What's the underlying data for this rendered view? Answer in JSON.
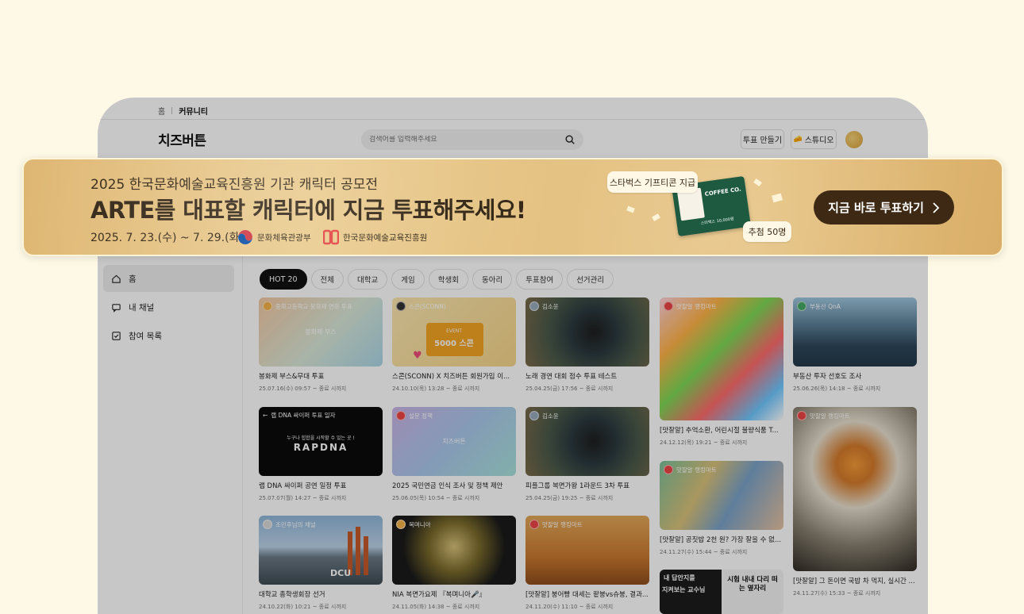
{
  "breadcrumb": {
    "home": "홈",
    "current": "커뮤니티"
  },
  "header": {
    "logo": "치즈버튼",
    "search_placeholder": "검색어를 입력해주세요",
    "make_vote": "투표 만들기",
    "studio": "스튜디오"
  },
  "banner": {
    "subtitle": "2025 한국문화예술교육진흥원 기관 캐릭터 공모전",
    "title": "ARTE를 대표할 캐릭터에 지금 투표해주세요!",
    "date": "2025. 7. 23.(수) ~ 7. 29.(화)",
    "org1": "문화체육관광부",
    "org2": "한국문화예술교육진흥원",
    "prize_label": "스타벅스 기프티콘 지급",
    "winners": "추첨 50명",
    "gift_brand": "COFFEE CO.",
    "gift_amount": "스타벅스 10,000원",
    "cta": "지금 바로 투표하기"
  },
  "sidebar": {
    "items": [
      {
        "label": "홈",
        "icon": "home-icon"
      },
      {
        "label": "내 채널",
        "icon": "chat-icon"
      },
      {
        "label": "참여 목록",
        "icon": "checkbox-icon"
      }
    ]
  },
  "chips": [
    "HOT 20",
    "전체",
    "대학교",
    "게임",
    "학생회",
    "동아리",
    "투표참여",
    "선거관리"
  ],
  "cards": [
    {
      "channel": "중화고등학교 봉화제 연화 투표",
      "center": "봉화제 부스",
      "title": "봉화제 부스&무대 투표",
      "meta": "25.07.16(수) 09:57 ~ 종료 시까지"
    },
    {
      "channel": "스콘(SCONN)",
      "center": "5000 스콘",
      "center_top": "EVENT",
      "title": "스콘(SCONN) X 치즈버튼 회원가입 이...",
      "meta": "24.10.10(목) 13:28 ~ 종료 시까지"
    },
    {
      "channel": "김소윤",
      "title": "노래 경연 대회 점수 투표 테스트",
      "meta": "25.04.25(금) 17:56 ~ 종료 시까지"
    },
    {
      "channel": "맛잘알 랭킹마트",
      "title": "[맛잘알] 추억소환, 어린시절 불량식품 T...",
      "meta": "24.12.12(목) 19:21 ~ 종료 시까지"
    },
    {
      "channel": "부동산 QnA",
      "title": "부동산 투자 선호도 조사",
      "meta": "25.06.26(목) 14:18 ~ 종료 시까지"
    },
    {
      "channel": "랩 DNA 싸이퍼 투표 일자",
      "center_top": "누구나 힙합을 시작할 수 있는 곳 !",
      "center": "RAPDNA",
      "title": "랩 DNA 싸이퍼 공연 일정 투표",
      "meta": "25.07.07(월) 14:27 ~ 종료 시까지"
    },
    {
      "channel": "설문 정책",
      "center": "치즈버튼",
      "title": "2025 국민연금 인식 조사 및 정책 제안",
      "meta": "25.06.05(목) 10:54 ~ 종료 시까지"
    },
    {
      "channel": "김소윤",
      "title": "피플그룹 복면가왕 1라운드 3차 투표",
      "meta": "25.04.25(금) 19:25 ~ 종료 시까지"
    },
    {
      "channel": "맛잘알 랭킹마트",
      "title": "[맛잘알] 공짓밥 2천 원? 가장 잘을 수 없...",
      "meta": "24.11.27(수) 15:44 ~ 종료 시까지"
    },
    {
      "channel": "맛잘알 랭킹마트",
      "title": "[맛잘알] 그 돈이면 국밥 차 먹지, 실시간 ...",
      "meta": "24.11.27(수) 15:33 ~ 종료 시까지"
    },
    {
      "channel": "조민후님의 채널",
      "center": "DCU",
      "title": "대학교 총학생회장 선거",
      "meta": "24.10.22(화) 10:21 ~ 종료 시까지"
    },
    {
      "channel": "복며니아",
      "title": "NIA 복면가요제 『복며니아🎤』",
      "meta": "24.11.05(화) 14:38 ~ 종료 시까지"
    },
    {
      "channel": "맛잘알 랭킹마트",
      "title": "[맛잘알] 붕어빵 대세는 팥붕vs슈붕, 결과...",
      "meta": "24.11.20(수) 11:10 ~ 종료 시까지"
    },
    {
      "channel": "내 답안지를",
      "center_top": "지켜보는 교수님",
      "center": "시험 내내 다리 떠는 옆자리",
      "title": "",
      "meta": ""
    }
  ],
  "colors": {
    "accent_dark": "#3e2914",
    "banner_gold": "#e3bf7d",
    "page_bg": "#fef9e6"
  }
}
